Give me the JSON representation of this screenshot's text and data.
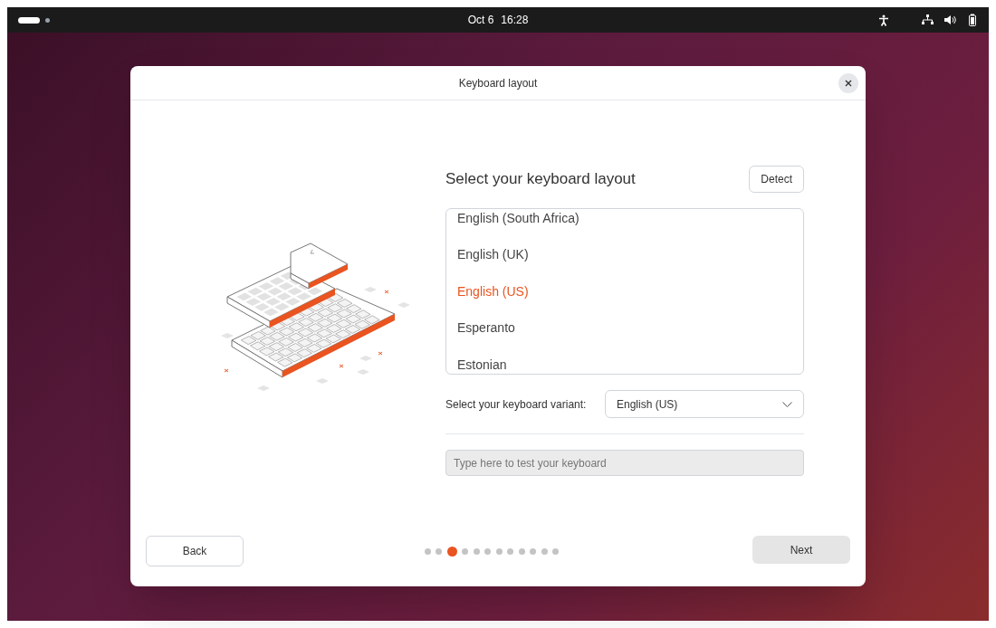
{
  "top_bar": {
    "date": "Oct 6",
    "time": "16:28"
  },
  "dialog": {
    "title": "Keyboard layout",
    "heading": "Select your keyboard layout",
    "detect_button": "Detect",
    "layouts": [
      {
        "label": "English (South Africa)",
        "selected": false
      },
      {
        "label": "English (UK)",
        "selected": false
      },
      {
        "label": "English (US)",
        "selected": true
      },
      {
        "label": "Esperanto",
        "selected": false
      },
      {
        "label": "Estonian",
        "selected": false
      }
    ],
    "variant_label": "Select your keyboard variant:",
    "variant_value": "English (US)",
    "test_field": {
      "placeholder": "Type here to test your keyboard"
    },
    "back_button": "Back",
    "next_button": "Next",
    "steps": [
      {
        "selected": false
      },
      {
        "selected": false
      },
      {
        "selected": true
      },
      {
        "selected": false
      },
      {
        "selected": false
      },
      {
        "selected": false
      },
      {
        "selected": false
      },
      {
        "selected": false
      },
      {
        "selected": false
      },
      {
        "selected": false
      },
      {
        "selected": false
      },
      {
        "selected": false
      }
    ]
  }
}
